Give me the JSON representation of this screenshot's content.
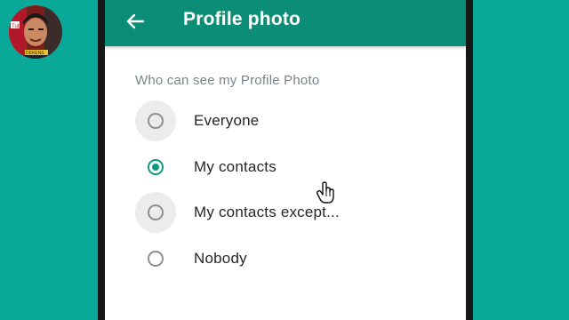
{
  "avatar": {
    "icon": "channel-avatar-photo",
    "sticker_text": "Tube",
    "badge_text": "DEKENS"
  },
  "appbar": {
    "back_icon": "arrow-left-icon",
    "title": "Profile photo",
    "color": "#0b8d77"
  },
  "section_label": "Who can see my Profile Photo",
  "options": [
    {
      "label": "Everyone",
      "selected": false
    },
    {
      "label": "My contacts",
      "selected": true
    },
    {
      "label": "My contacts except...",
      "selected": false
    },
    {
      "label": "Nobody",
      "selected": false
    }
  ],
  "colors": {
    "background": "#0aa898",
    "accent": "#0b9a80"
  }
}
